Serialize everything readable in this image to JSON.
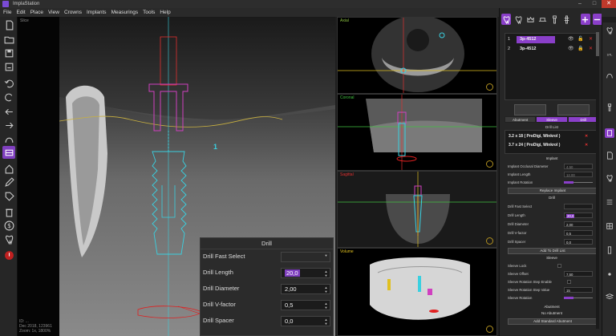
{
  "app": {
    "title": "ImplaStation"
  },
  "window": {
    "minimize": "–",
    "maximize": "□",
    "close": "✕"
  },
  "menu": [
    "File",
    "Edit",
    "Place",
    "View",
    "Crowns",
    "Implants",
    "Measurings",
    "Tools",
    "Help"
  ],
  "left_toolbar": [
    "new-file-icon",
    "open-file-icon",
    "save-icon",
    "save-as-icon",
    "undo-icon",
    "redo-icon",
    "arrow-left-icon",
    "arrow-right-icon",
    "rotate-icon",
    "rotate-left-icon",
    "curve-icon",
    "slice-view-icon",
    "house-icon",
    "pen-icon",
    "ruler-icon",
    "tag-icon",
    "gradient-icon",
    "delete-icon",
    "dollar-icon",
    "tooth-icon",
    "alert-icon"
  ],
  "main_view": {
    "label": "Slice",
    "implant_marker": "1",
    "corner_text": [
      "ID: ...",
      "Dec 2018, 123961",
      "Zoom: 1x, 1800%"
    ]
  },
  "drill_panel": {
    "title": "Drill",
    "rows": [
      {
        "label": "Drill Fast Select",
        "value": ""
      },
      {
        "label": "Drill Length",
        "value": "20,0"
      },
      {
        "label": "Drill Diameter",
        "value": "2,00"
      },
      {
        "label": "Drill V-factor",
        "value": "0,5"
      },
      {
        "label": "Drill Spacer",
        "value": "0,0"
      }
    ]
  },
  "views": {
    "axial": "Axial",
    "coronal": "Coronal",
    "sagittal": "Sagittal",
    "volume": "Volume"
  },
  "right_panel": {
    "implants": [
      {
        "num": "1",
        "name": "3p-4512"
      },
      {
        "num": "2",
        "name": "3p-4512"
      }
    ],
    "tabs": [
      "Abutment",
      "Sleeve",
      "Drill"
    ],
    "drill_list_label": "Drill List",
    "drill_list": [
      "3.2 x 18 ( ProDigi, Winkrol )",
      "3.7 x 24 ( ProDigi, Winkrol )"
    ],
    "implant_section": "Implant",
    "implant_fields": [
      {
        "label": "Implant Occlusal Diameter",
        "value": "4,50"
      },
      {
        "label": "Implant Length",
        "value": "12,00"
      },
      {
        "label": "Implant Rotation",
        "value": ""
      }
    ],
    "replace_implant": "Replace Implant",
    "drill_section": "Drill",
    "drill_fields": [
      {
        "label": "Drill Fast Select",
        "value": ""
      },
      {
        "label": "Drill Length",
        "value": "20,0"
      },
      {
        "label": "Drill Diameter",
        "value": "2,00"
      },
      {
        "label": "Drill V-factor",
        "value": "0,5"
      },
      {
        "label": "Drill Spacer",
        "value": "0,0"
      }
    ],
    "add_to_drill_list": "Add To Drill List",
    "sleeve_section": "Sleeve",
    "sleeve_fields": [
      {
        "label": "Sleeve Lock",
        "value": ""
      },
      {
        "label": "Sleeve Offset",
        "value": "7,50"
      },
      {
        "label": "Sleeve Rotation Step Enable",
        "value": ""
      },
      {
        "label": "Sleeve Rotation Step Value",
        "value": "15"
      },
      {
        "label": "Sleeve Rotation",
        "value": ""
      }
    ],
    "abutment_section": "Abutment",
    "no_abutment": "No Abutment",
    "add_standard_abutment": "Add Standard Abutment"
  },
  "far_right": [
    "tooth-view-icon",
    "stl-icon",
    "arch-icon",
    "implant-icon",
    "skull-icon",
    "file-icon",
    "tooth-outline-icon",
    "shelf-icon",
    "grid-icon",
    "ruler-v-icon",
    "dot-icon",
    "layers-icon"
  ],
  "colors": {
    "accent": "#8a3fc9",
    "implant": "#3ad0e0",
    "abutment": "#d040c0",
    "nerve": "#e02020",
    "bone_line": "#c8b040"
  }
}
